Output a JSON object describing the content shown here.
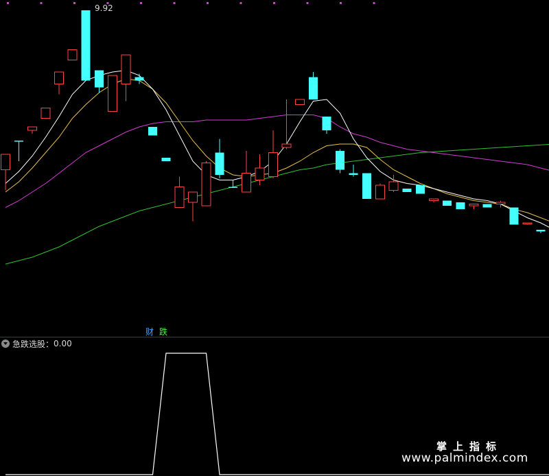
{
  "chart_data": {
    "type": "candlestick",
    "price_max_label": "9.92",
    "marker_cai": "财",
    "marker_die": "跌",
    "candles": [
      {
        "o": 0.5,
        "h": 1.0,
        "l": -0.7,
        "c": 1.4,
        "u": true
      },
      {
        "o": 2.2,
        "h": 2.2,
        "l": 1.0,
        "c": 2.2,
        "u": false
      },
      {
        "o": 2.8,
        "h": 2.8,
        "l": 2.6,
        "c": 3.0,
        "u": true
      },
      {
        "o": 3.5,
        "h": 3.0,
        "l": 3.8,
        "c": 4.1,
        "u": true
      },
      {
        "o": 5.5,
        "h": 5.5,
        "l": 4.9,
        "c": 6.2,
        "u": true
      },
      {
        "o": 6.9,
        "h": 6.2,
        "l": 7.4,
        "c": 7.5,
        "u": true
      },
      {
        "o": 9.8,
        "h": 9.8,
        "l": 9.9,
        "c": 5.7,
        "u": false
      },
      {
        "o": 6.3,
        "h": 6.3,
        "l": 5.0,
        "c": 5.3,
        "u": false
      },
      {
        "o": 3.9,
        "h": 4.1,
        "l": 4.0,
        "c": 6.0,
        "u": true
      },
      {
        "o": 5.5,
        "h": 5.8,
        "l": 4.5,
        "c": 7.2,
        "u": true
      },
      {
        "o": 5.9,
        "h": 6.1,
        "l": 5.5,
        "c": 5.7,
        "u": false
      },
      {
        "o": 3.0,
        "h": 3.0,
        "l": 2.5,
        "c": 2.5,
        "u": false
      },
      {
        "o": 1.2,
        "h": 1.2,
        "l": 1.5,
        "c": 1.0,
        "u": false
      },
      {
        "o": -1.7,
        "h": 0.1,
        "l": -1.6,
        "c": -0.5,
        "u": true
      },
      {
        "o": -1.4,
        "h": -0.8,
        "l": -2.5,
        "c": -0.8,
        "u": true
      },
      {
        "o": -1.6,
        "h": 1.0,
        "l": -1.3,
        "c": 0.9,
        "u": true
      },
      {
        "o": 0.2,
        "h": 2.3,
        "l": 0.0,
        "c": 1.5,
        "u": false
      },
      {
        "o": -0.5,
        "h": -0.1,
        "l": -0.1,
        "c": -0.5,
        "u": false
      },
      {
        "o": -0.8,
        "h": 1.6,
        "l": -0.8,
        "c": 0.3,
        "u": true
      },
      {
        "o": -0.1,
        "h": 1.4,
        "l": -0.4,
        "c": 0.6,
        "u": true
      },
      {
        "o": 0.1,
        "h": 2.8,
        "l": 0.0,
        "c": 1.5,
        "u": true
      },
      {
        "o": 1.8,
        "h": 4.6,
        "l": 1.7,
        "c": 2.0,
        "u": true
      },
      {
        "o": 4.3,
        "h": 4.6,
        "l": 4.5,
        "c": 4.6,
        "u": true
      },
      {
        "o": 5.9,
        "h": 6.2,
        "l": 5.8,
        "c": 4.6,
        "u": false
      },
      {
        "o": 3.6,
        "h": 3.6,
        "l": 2.6,
        "c": 2.8,
        "u": false
      },
      {
        "o": 1.6,
        "h": 1.7,
        "l": 0.3,
        "c": 0.5,
        "u": false
      },
      {
        "o": 0.3,
        "h": 0.8,
        "l": 0.1,
        "c": 0.2,
        "u": false
      },
      {
        "o": 0.3,
        "h": 0.3,
        "l": -1.2,
        "c": -1.2,
        "u": false
      },
      {
        "o": -1.2,
        "h": -0.3,
        "l": -1.2,
        "c": -0.4,
        "u": true
      },
      {
        "o": -0.2,
        "h": 0.2,
        "l": -0.8,
        "c": -0.7,
        "u": true
      },
      {
        "o": -0.6,
        "h": -0.7,
        "l": -0.8,
        "c": -0.8,
        "u": false
      },
      {
        "o": -0.4,
        "h": -0.5,
        "l": -0.9,
        "c": -0.9,
        "u": false
      },
      {
        "o": -1.2,
        "h": -1.3,
        "l": -1.4,
        "c": -1.3,
        "u": true
      },
      {
        "o": -1.3,
        "h": -1.3,
        "l": -1.6,
        "c": -1.6,
        "u": false
      },
      {
        "o": -1.4,
        "h": -1.4,
        "l": -1.8,
        "c": -1.8,
        "u": false
      },
      {
        "o": -1.5,
        "h": -1.5,
        "l": -1.8,
        "c": -1.6,
        "u": true
      },
      {
        "o": -1.5,
        "h": -1.5,
        "l": -1.7,
        "c": -1.7,
        "u": false
      },
      {
        "o": -1.4,
        "h": -1.3,
        "l": -1.7,
        "c": -1.5,
        "u": true
      },
      {
        "o": -1.7,
        "h": -1.7,
        "l": -2.7,
        "c": -2.7,
        "u": false
      },
      {
        "o": -2.6,
        "h": -2.6,
        "l": -2.7,
        "c": -2.6,
        "u": true
      },
      {
        "o": -3.0,
        "h": -3.0,
        "l": -3.2,
        "c": -3.1,
        "u": false
      },
      {
        "o": -3.2,
        "h": -3.0,
        "l": -3.3,
        "c": -3.3,
        "u": false
      }
    ],
    "ma_white": [
      -0.3,
      0.4,
      1.3,
      2.4,
      3.6,
      4.9,
      5.7,
      6.0,
      6.2,
      6.3,
      6.0,
      5.2,
      4.0,
      2.5,
      1.0,
      0.2,
      -0.1,
      -0.1,
      0.1,
      0.4,
      1.0,
      2.0,
      3.3,
      4.5,
      4.6,
      3.8,
      2.3,
      1.2,
      0.4,
      -0.1,
      -0.3,
      -0.4,
      -0.6,
      -0.8,
      -1.0,
      -1.2,
      -1.3,
      -1.5,
      -1.9,
      -2.3,
      -2.6,
      -3.0
    ],
    "ma_yellow": [
      -0.8,
      -0.2,
      0.6,
      1.5,
      2.4,
      3.5,
      4.3,
      5.0,
      5.5,
      5.8,
      5.7,
      5.2,
      4.4,
      3.3,
      2.2,
      1.3,
      0.6,
      0.2,
      0.1,
      0.2,
      0.3,
      0.6,
      1.0,
      1.5,
      1.9,
      2.0,
      2.0,
      1.8,
      1.1,
      0.5,
      0.1,
      -0.3,
      -0.6,
      -0.9,
      -1.1,
      -1.3,
      -1.4,
      -1.5,
      -1.8,
      -2.0,
      -2.3,
      -2.6
    ],
    "ma_magenta": [
      -1.7,
      -1.3,
      -0.8,
      -0.3,
      0.3,
      0.9,
      1.5,
      1.9,
      2.3,
      2.7,
      3.0,
      3.2,
      3.3,
      3.3,
      3.3,
      3.4,
      3.4,
      3.4,
      3.4,
      3.5,
      3.6,
      3.7,
      3.7,
      3.7,
      3.5,
      3.0,
      2.6,
      2.4,
      2.1,
      1.9,
      1.7,
      1.6,
      1.5,
      1.4,
      1.3,
      1.2,
      1.1,
      1.0,
      0.9,
      0.8,
      0.6,
      0.4
    ],
    "ma_green": [
      -5.0,
      -4.8,
      -4.6,
      -4.3,
      -4.0,
      -3.6,
      -3.2,
      -2.8,
      -2.5,
      -2.2,
      -1.9,
      -1.7,
      -1.5,
      -1.3,
      -1.1,
      -0.9,
      -0.7,
      -0.5,
      -0.3,
      -0.1,
      0.1,
      0.3,
      0.5,
      0.6,
      0.8,
      0.9,
      1.0,
      1.1,
      1.2,
      1.3,
      1.4,
      1.5,
      1.55,
      1.6,
      1.65,
      1.7,
      1.75,
      1.8,
      1.85,
      1.9,
      1.95,
      2.0
    ],
    "indicator": {
      "title": "急跌选股：",
      "value": "0.00",
      "signal": [
        0,
        0,
        0,
        0,
        0,
        0,
        0,
        0,
        0,
        0,
        0,
        0,
        1,
        1,
        1,
        1,
        0,
        0,
        0,
        0,
        0,
        0,
        0,
        0,
        0,
        0,
        0,
        0,
        0,
        0,
        0,
        0,
        0,
        0,
        0,
        0,
        0,
        0,
        0,
        0,
        0,
        0
      ]
    }
  },
  "colors": {
    "up": "#ff4444",
    "down": "#44ffff",
    "ma_white": "#ffffff",
    "ma_yellow": "#e8c34a",
    "ma_magenta": "#d63bd6",
    "ma_green": "#2fc42f",
    "separator": "#8b1a1a",
    "top_dots": "#d93bd9"
  },
  "watermark": {
    "cn": "掌上指标",
    "url": "www.palmindex.com"
  }
}
